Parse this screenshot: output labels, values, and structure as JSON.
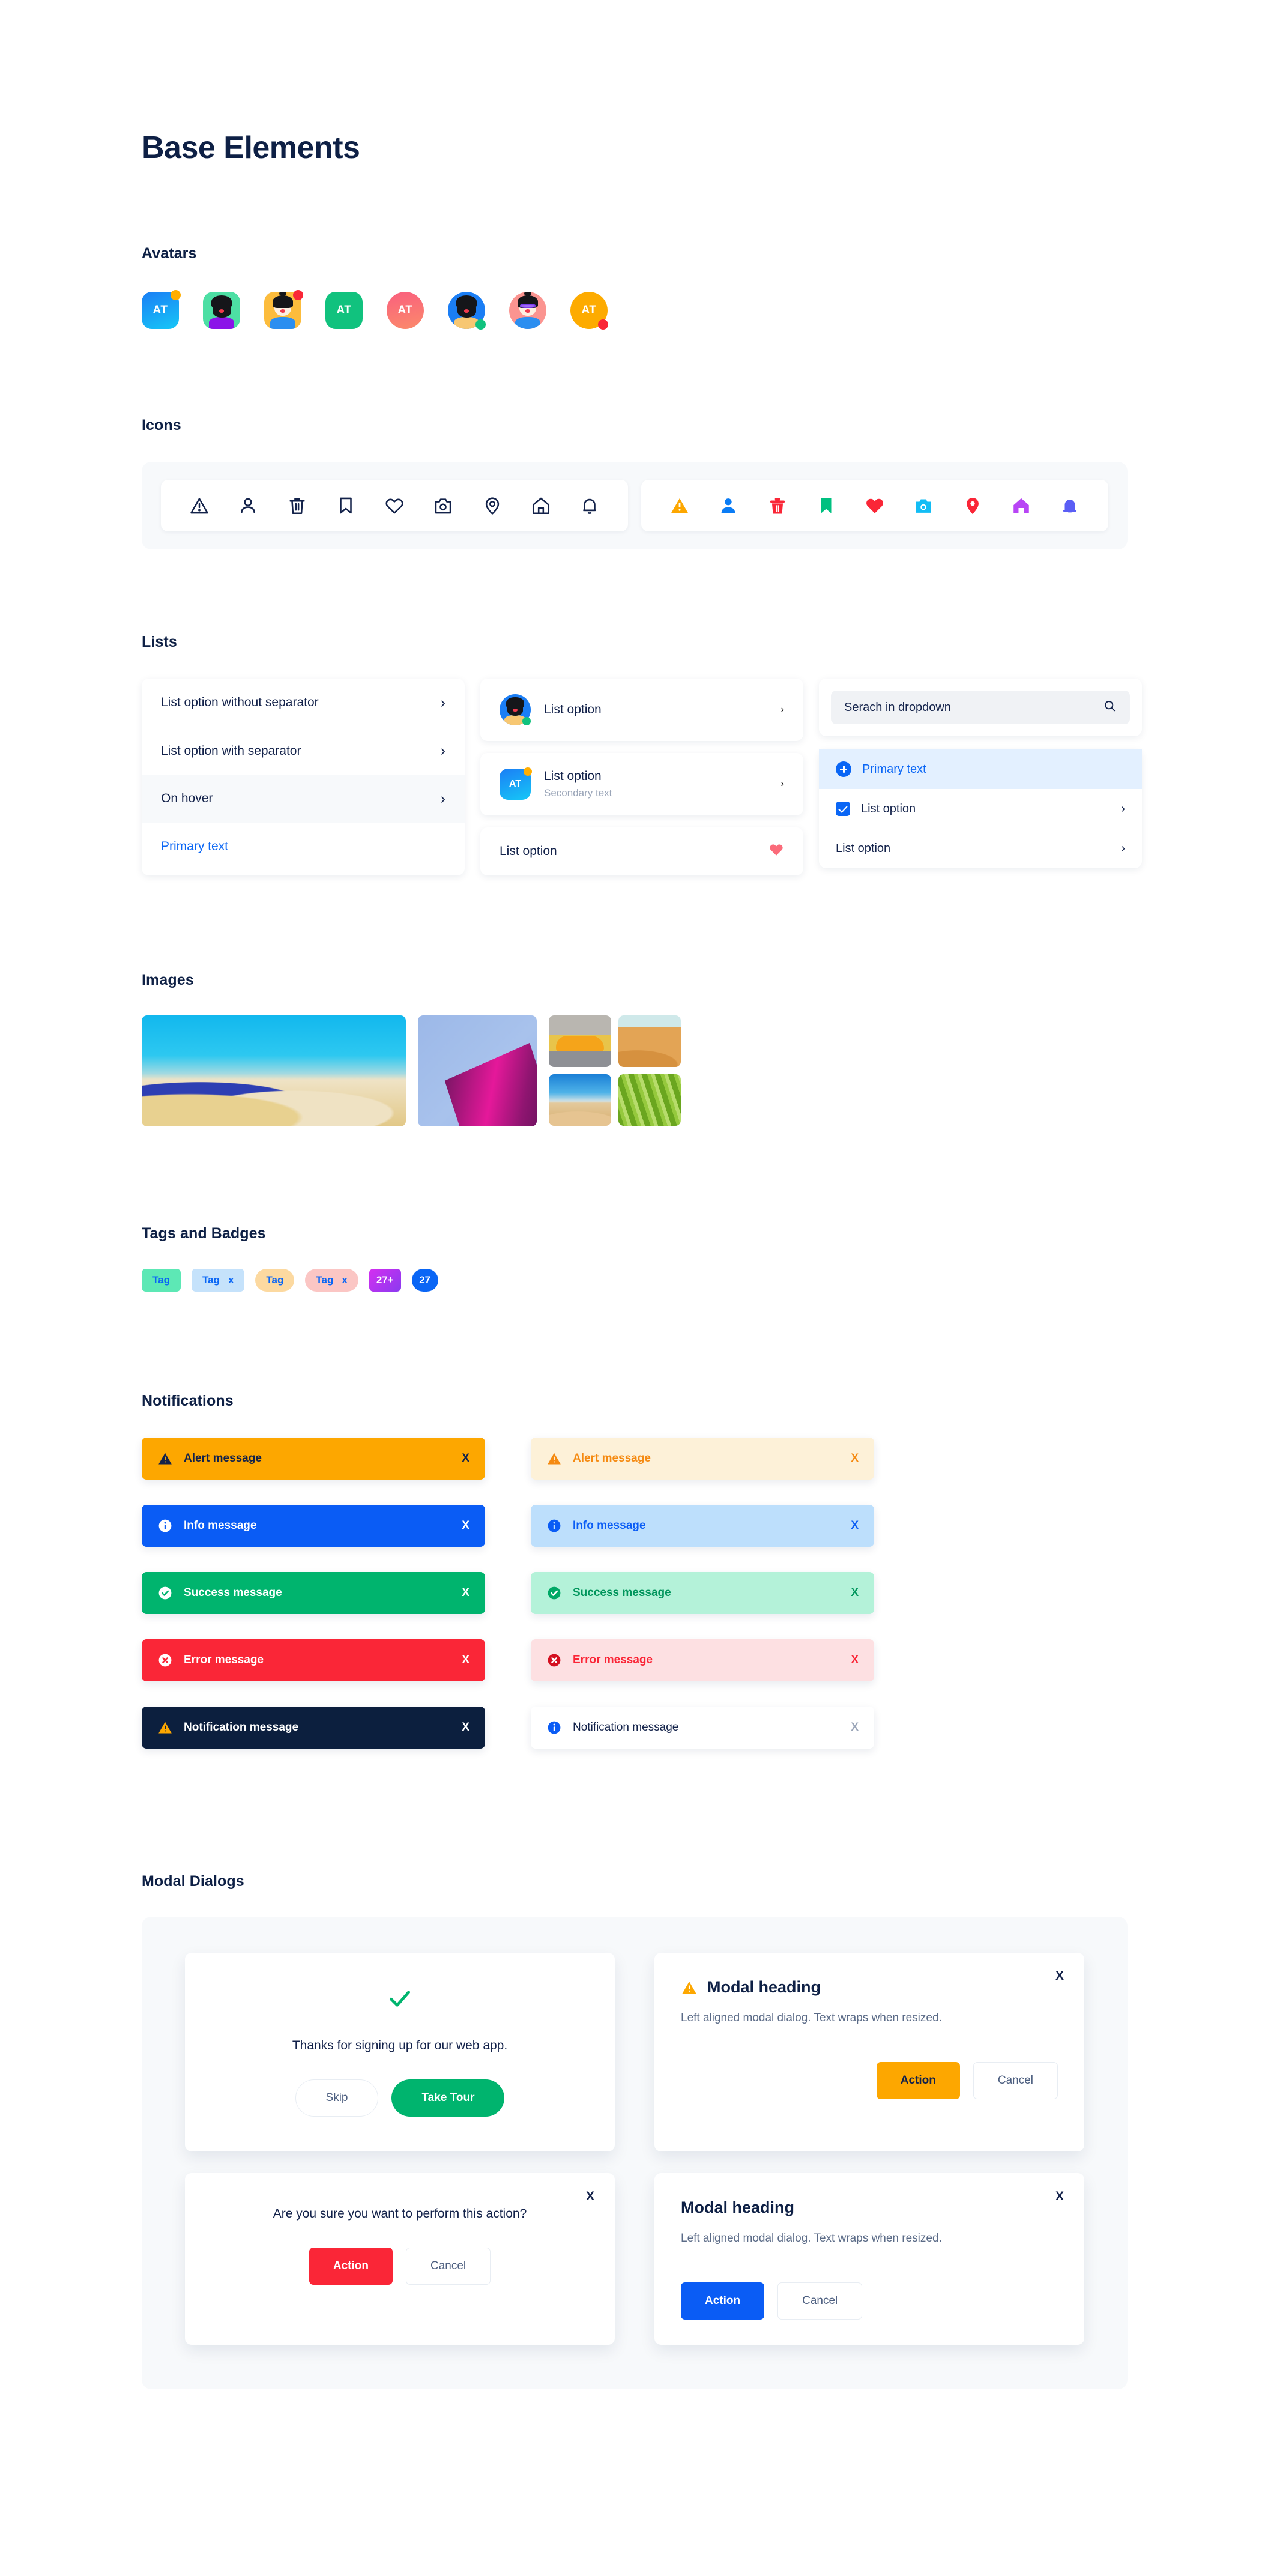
{
  "page": {
    "title": "Base Elements"
  },
  "sections": {
    "avatars": "Avatars",
    "icons": "Icons",
    "lists": "Lists",
    "images": "Images",
    "tags": "Tags and Badges",
    "notifications": "Notifications",
    "modals": "Modal Dialogs"
  },
  "avatars": [
    {
      "name": "avatar-initials-square-blue",
      "kind": "initials",
      "shape": "square",
      "initials": "AT",
      "bg": "linear-gradient(160deg,#1b7ef5,#16c7f7)",
      "status": "#ffae00",
      "status_pos": "tr"
    },
    {
      "name": "avatar-illustration-square-green",
      "kind": "person",
      "shape": "square",
      "initials": "",
      "bg": "#4ddfa4",
      "body": "#8b14e8",
      "status": "",
      "status_pos": ""
    },
    {
      "name": "avatar-illustration-square-amber",
      "kind": "person-bun",
      "shape": "square",
      "initials": "",
      "bg": "#fcbc3c",
      "body": "#2b8ef0",
      "status": "#fa2637",
      "status_pos": "tr"
    },
    {
      "name": "avatar-initials-square-teal",
      "kind": "initials",
      "shape": "square",
      "initials": "AT",
      "bg": "#11c27e",
      "status": "",
      "status_pos": ""
    },
    {
      "name": "avatar-initials-circle-pink",
      "kind": "initials",
      "shape": "circle",
      "initials": "AT",
      "bg": "linear-gradient(170deg,#fa5f7e,#fb8a6b)",
      "status": "",
      "status_pos": ""
    },
    {
      "name": "avatar-illustration-circle-blue",
      "kind": "person",
      "shape": "circle",
      "initials": "",
      "bg": "#1b7ef5",
      "body": "#f7c772",
      "status": "#11c27e",
      "status_pos": "br"
    },
    {
      "name": "avatar-illustration-circle-salmon",
      "kind": "person-bun",
      "shape": "circle",
      "initials": "",
      "bg": "#fb9490",
      "body": "#2b8ef0",
      "status": "",
      "status_pos": ""
    },
    {
      "name": "avatar-initials-circle-orange",
      "kind": "initials",
      "shape": "circle",
      "initials": "AT",
      "bg": "#fdab00",
      "status": "#fa2637",
      "status_pos": "br"
    }
  ],
  "icons": {
    "outline_set": [
      "warning-triangle",
      "user",
      "trash",
      "bookmark",
      "heart",
      "camera",
      "location-pin",
      "home",
      "bell"
    ],
    "filled_set": [
      "warning-triangle",
      "user",
      "trash",
      "bookmark",
      "heart",
      "camera",
      "location-pin",
      "home",
      "bell"
    ],
    "outline_color": "#13224a",
    "filled_colors": [
      "#fda700",
      "#0a7cf5",
      "#fa2637",
      "#00c080",
      "#fa2637",
      "#12bdf5",
      "#fa2637",
      "#b845f5",
      "#5a5ef5"
    ]
  },
  "lists": {
    "column_one": [
      {
        "label": "List option without separator",
        "separator": false,
        "state": "default",
        "trailing": "chevron"
      },
      {
        "label": "List option with separator",
        "separator": true,
        "state": "default",
        "trailing": "chevron"
      },
      {
        "label": "On hover",
        "separator": false,
        "state": "hover",
        "trailing": "chevron"
      },
      {
        "label": "Primary text",
        "separator": false,
        "state": "primary",
        "trailing": "none"
      }
    ],
    "column_two": [
      {
        "label": "List option",
        "secondary": "",
        "avatar": "person-circle-blue",
        "trailing": "chevron"
      },
      {
        "label": "List option",
        "secondary": "Secondary text",
        "avatar": "initials-square-blue",
        "avatar_initials": "AT",
        "trailing": "chevron"
      },
      {
        "label": "List option",
        "secondary": "",
        "avatar": "",
        "trailing": "heart"
      }
    ],
    "column_three": {
      "search_placeholder": "Serach in dropdown",
      "search_value": "",
      "items": [
        {
          "label": "Primary text",
          "leading": "plus-circle",
          "state": "active",
          "trailing": "none",
          "separator": false
        },
        {
          "label": "List option",
          "leading": "checkbox-checked",
          "state": "default",
          "trailing": "chevron",
          "separator": false
        },
        {
          "label": "List option",
          "leading": "none",
          "state": "default",
          "trailing": "chevron",
          "separator": true
        }
      ]
    }
  },
  "images": [
    {
      "name": "white-sands-dunes",
      "size": "large"
    },
    {
      "name": "pink-glass-building",
      "size": "medium"
    },
    {
      "name": "yellow-classic-car",
      "size": "small"
    },
    {
      "name": "orange-sand-dune",
      "size": "small"
    },
    {
      "name": "blue-sky-dune",
      "size": "small"
    },
    {
      "name": "green-palm-leaves",
      "size": "small"
    }
  ],
  "tags": [
    {
      "label": "Tag",
      "closable": false,
      "shape": "square",
      "bg": "#5de8b5",
      "fg": "#0a66f5"
    },
    {
      "label": "Tag",
      "closable": true,
      "shape": "square",
      "bg": "#c5e2fb",
      "fg": "#0a66f5",
      "close": "x"
    },
    {
      "label": "Tag",
      "closable": false,
      "shape": "round",
      "bg": "#fcd9a0",
      "fg": "#0a66f5"
    },
    {
      "label": "Tag",
      "closable": true,
      "shape": "round",
      "bg": "#fbc6c4",
      "fg": "#0a66f5",
      "close": "x"
    }
  ],
  "badges": [
    {
      "label": "27+",
      "shape": "square",
      "bg": "linear-gradient(135deg,#d42ff0,#8a3af0)",
      "fg": "#ffffff"
    },
    {
      "label": "27",
      "shape": "circle",
      "bg": "#0a66f5",
      "fg": "#ffffff"
    }
  ],
  "notifications": {
    "solid": [
      {
        "label": "Alert message",
        "icon": "warning-triangle",
        "bg": "#fda700",
        "fg": "#13224a",
        "icon_color": "#13224a",
        "close": "X"
      },
      {
        "label": "Info message",
        "icon": "info-circle",
        "bg": "#0a5cf5",
        "fg": "#ffffff",
        "icon_color": "#ffffff",
        "close": "X"
      },
      {
        "label": "Success message",
        "icon": "check-circle",
        "bg": "#00b46e",
        "fg": "#ffffff",
        "icon_color": "#ffffff",
        "close": "X"
      },
      {
        "label": "Error message",
        "icon": "error-circle",
        "bg": "#fa2637",
        "fg": "#ffffff",
        "icon_color": "#ffffff",
        "close": "X"
      },
      {
        "label": "Notification message",
        "icon": "warning-triangle",
        "bg": "#0c1f3e",
        "fg": "#ffffff",
        "icon_color": "#fda700",
        "close": "X"
      }
    ],
    "soft": [
      {
        "label": "Alert message",
        "icon": "warning-triangle",
        "bg": "#fdf1d8",
        "fg": "#f58a11",
        "icon_color": "#f58a11",
        "close": "X"
      },
      {
        "label": "Info message",
        "icon": "info-circle",
        "bg": "#bddffc",
        "fg": "#0a5cf5",
        "icon_color": "#0a5cf5",
        "close": "X"
      },
      {
        "label": "Success message",
        "icon": "check-circle",
        "bg": "#b4f2d9",
        "fg": "#00955c",
        "icon_color": "#00955c",
        "close": "X"
      },
      {
        "label": "Error message",
        "icon": "error-circle",
        "bg": "#fde0e2",
        "fg": "#fa2637",
        "icon_color": "#d41020",
        "close": "X"
      },
      {
        "label": "Notification message",
        "icon": "info-circle",
        "bg": "#ffffff",
        "fg": "#13224a",
        "icon_color": "#0a5cf5",
        "close": "X"
      }
    ]
  },
  "modals": {
    "signup": {
      "icon": "check-mark",
      "icon_color": "#00b46e",
      "message": "Thanks for signing up for our web app.",
      "secondary_button": "Skip",
      "primary_button": "Take Tour"
    },
    "alert": {
      "icon": "warning-triangle",
      "icon_color": "#fda700",
      "heading": "Modal heading",
      "body": "Left aligned modal dialog. Text wraps when resized.",
      "primary_button": "Action",
      "secondary_button": "Cancel",
      "close": "X"
    },
    "confirm": {
      "message": "Are you sure you want to perform this action?",
      "primary_button": "Action",
      "secondary_button": "Cancel",
      "close": "X"
    },
    "info": {
      "heading": "Modal heading",
      "body": "Left aligned modal dialog. Text wraps when resized.",
      "primary_button": "Action",
      "secondary_button": "Cancel",
      "close": "X"
    }
  }
}
